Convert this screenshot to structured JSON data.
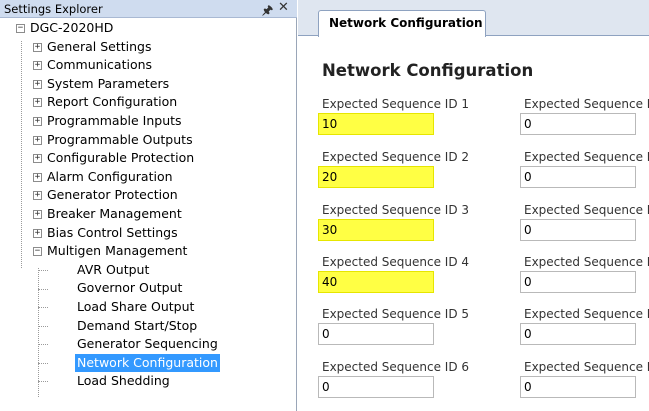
{
  "explorer": {
    "title": "Settings Explorer",
    "pin_icon": "pin-icon",
    "close_icon": "close-icon",
    "root": {
      "label": "DGC-2020HD",
      "toggle": "−"
    },
    "items": [
      {
        "label": "General Settings",
        "toggle": "+"
      },
      {
        "label": "Communications",
        "toggle": "+"
      },
      {
        "label": "System Parameters",
        "toggle": "+"
      },
      {
        "label": "Report Configuration",
        "toggle": "+"
      },
      {
        "label": "Programmable Inputs",
        "toggle": "+"
      },
      {
        "label": "Programmable Outputs",
        "toggle": "+"
      },
      {
        "label": "Configurable Protection",
        "toggle": "+"
      },
      {
        "label": "Alarm Configuration",
        "toggle": "+"
      },
      {
        "label": "Generator Protection",
        "toggle": "+"
      },
      {
        "label": "Breaker Management",
        "toggle": "+"
      },
      {
        "label": "Bias Control Settings",
        "toggle": "+"
      },
      {
        "label": "Multigen Management",
        "toggle": "−"
      }
    ],
    "children": [
      {
        "label": "AVR Output"
      },
      {
        "label": "Governor Output"
      },
      {
        "label": "Load Share Output"
      },
      {
        "label": "Demand Start/Stop"
      },
      {
        "label": "Generator Sequencing"
      },
      {
        "label": "Network Configuration",
        "selected": true
      },
      {
        "label": "Load Shedding"
      }
    ]
  },
  "tab": {
    "label": "Network Configuration"
  },
  "main": {
    "title": "Network Configuration",
    "left_fields": [
      {
        "label": "Expected Sequence ID 1",
        "value": "10",
        "highlighted": true
      },
      {
        "label": "Expected Sequence ID 2",
        "value": "20",
        "highlighted": true
      },
      {
        "label": "Expected Sequence ID 3",
        "value": "30",
        "highlighted": true
      },
      {
        "label": "Expected Sequence ID 4",
        "value": "40",
        "highlighted": true
      },
      {
        "label": "Expected Sequence ID 5",
        "value": "0",
        "highlighted": false
      },
      {
        "label": "Expected Sequence ID 6",
        "value": "0",
        "highlighted": false
      }
    ],
    "right_fields": [
      {
        "label": "Expected Sequence ID",
        "value": "0"
      },
      {
        "label": "Expected Sequence ID",
        "value": "0"
      },
      {
        "label": "Expected Sequence ID",
        "value": "0"
      },
      {
        "label": "Expected Sequence ID",
        "value": "0"
      },
      {
        "label": "Expected Sequence ID",
        "value": "0"
      },
      {
        "label": "Expected Sequence ID",
        "value": "0"
      }
    ]
  },
  "colors": {
    "highlight": "#ffff44",
    "selection": "#3399ff",
    "header": "#cfdcef"
  }
}
